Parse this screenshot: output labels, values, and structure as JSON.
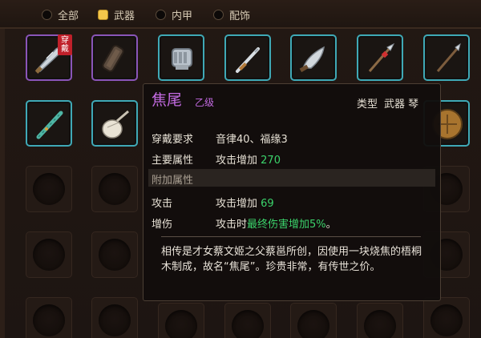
{
  "filters": [
    {
      "label": "全部",
      "selected": false
    },
    {
      "label": "武器",
      "selected": true
    },
    {
      "label": "内甲",
      "selected": false
    },
    {
      "label": "配饰",
      "selected": false
    }
  ],
  "items": [
    {
      "icon": "curved-blade-icon",
      "worn": true,
      "worn_label": "穿戴"
    },
    {
      "icon": "scroll-bundle-icon",
      "worn": false
    },
    {
      "icon": "gauntlet-icon",
      "worn": false
    },
    {
      "icon": "straight-sword-icon",
      "worn": false
    },
    {
      "icon": "broad-sabre-icon",
      "worn": false
    },
    {
      "icon": "spear-icon",
      "worn": false
    },
    {
      "icon": "lance-icon",
      "worn": false
    },
    {
      "icon": "flute-icon",
      "worn": false
    },
    {
      "icon": "pipa-icon",
      "worn": false
    }
  ],
  "tooltip": {
    "name": "焦尾",
    "grade": "乙级",
    "type_label": "类型",
    "type_value": "武器 琴",
    "requirement_label": "穿戴要求",
    "requirement_value": "音律40、福缘3",
    "main_attr_label": "主要属性",
    "main_attr_text": "攻击增加",
    "main_attr_value": "270",
    "extra_title": "附加属性",
    "attack_label": "攻击",
    "attack_text": "攻击增加",
    "attack_value": "69",
    "damage_label": "增伤",
    "damage_prefix": "攻击时",
    "damage_effect": "最终伤害增加5%",
    "damage_suffix": "。",
    "description": "相传是才女蔡文姬之父蔡邕所创，因使用一块烧焦的梧桐木制成，故名“焦尾”。珍贵非常，有传世之价。"
  },
  "colors": {
    "rarity_purple": "#c26ae0",
    "stat_green": "#3bd36b",
    "slot_border_blue": "#3fa9b6",
    "slot_border_worn": "#8a55b8",
    "selected_filter": "#f3c64b",
    "worn_badge": "#c0202a"
  }
}
